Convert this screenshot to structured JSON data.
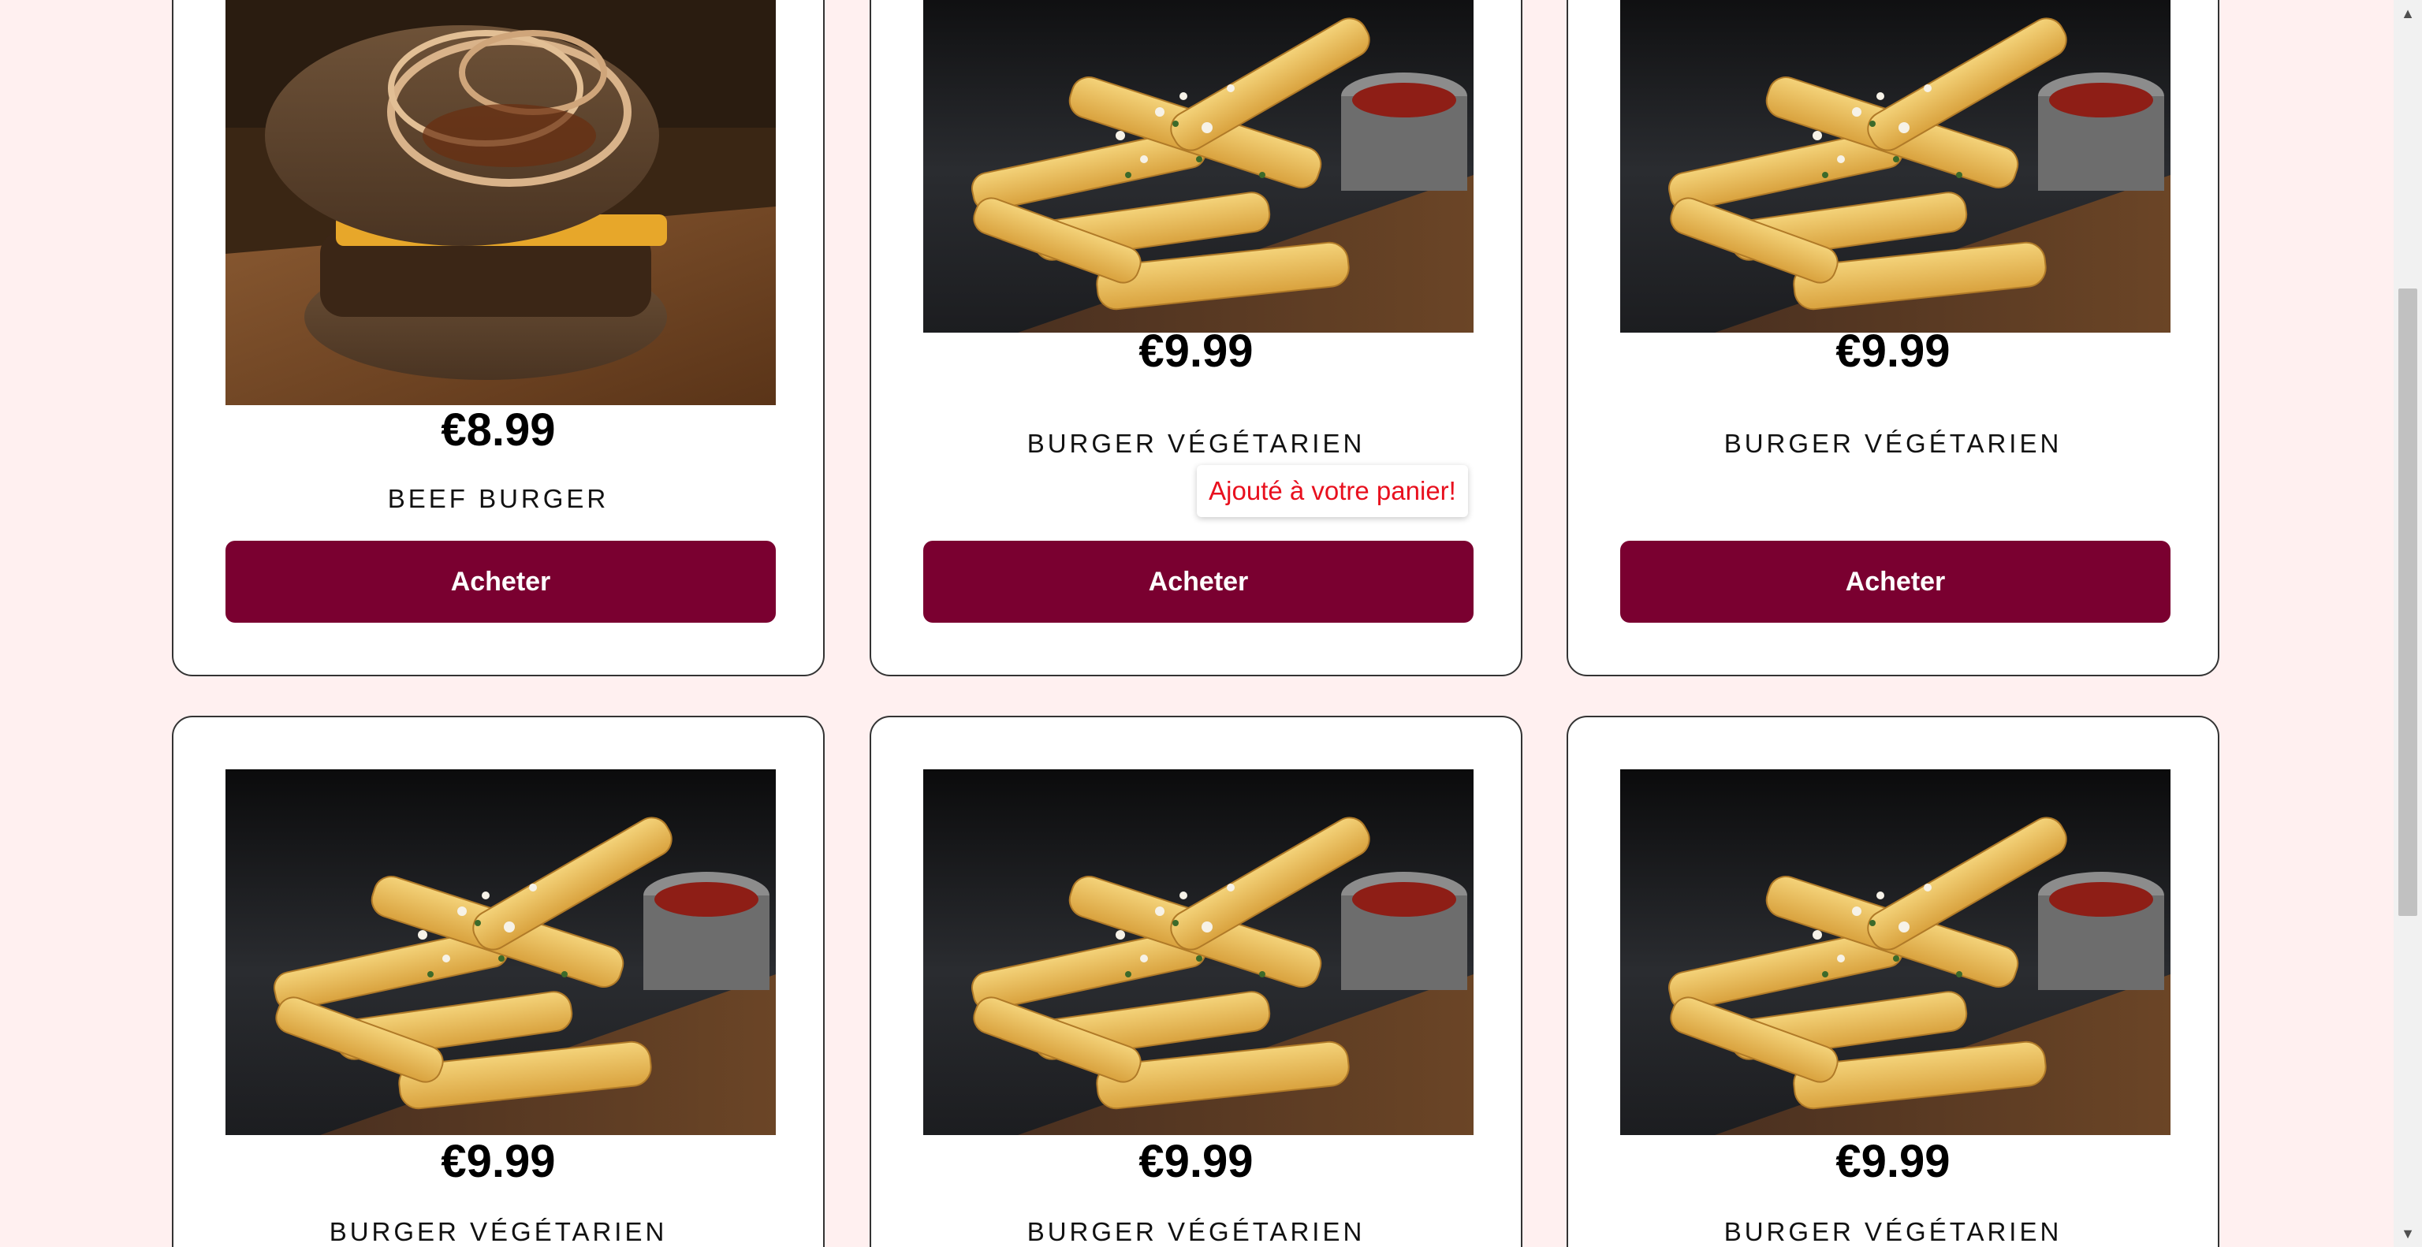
{
  "products": [
    {
      "price": "€8.99",
      "name": "BEEF BURGER",
      "button": "Acheter",
      "image": "beef-burger-photo"
    },
    {
      "price": "€9.99",
      "name": "BURGER VÉGÉTARIEN",
      "button": "Acheter",
      "image": "fries-photo"
    },
    {
      "price": "€9.99",
      "name": "BURGER VÉGÉTARIEN",
      "button": "Acheter",
      "image": "fries-photo"
    },
    {
      "price": "€9.99",
      "name": "BURGER VÉGÉTARIEN",
      "button": "Acheter",
      "image": "fries-photo"
    },
    {
      "price": "€9.99",
      "name": "BURGER VÉGÉTARIEN",
      "button": "Acheter",
      "image": "fries-photo"
    },
    {
      "price": "€9.99",
      "name": "BURGER VÉGÉTARIEN",
      "button": "Acheter",
      "image": "fries-photo"
    }
  ],
  "toast": {
    "message": "Ajouté à votre panier!"
  },
  "colors": {
    "background": "#fff0f0",
    "button": "#7a0030",
    "toast_text": "#e8101e"
  }
}
